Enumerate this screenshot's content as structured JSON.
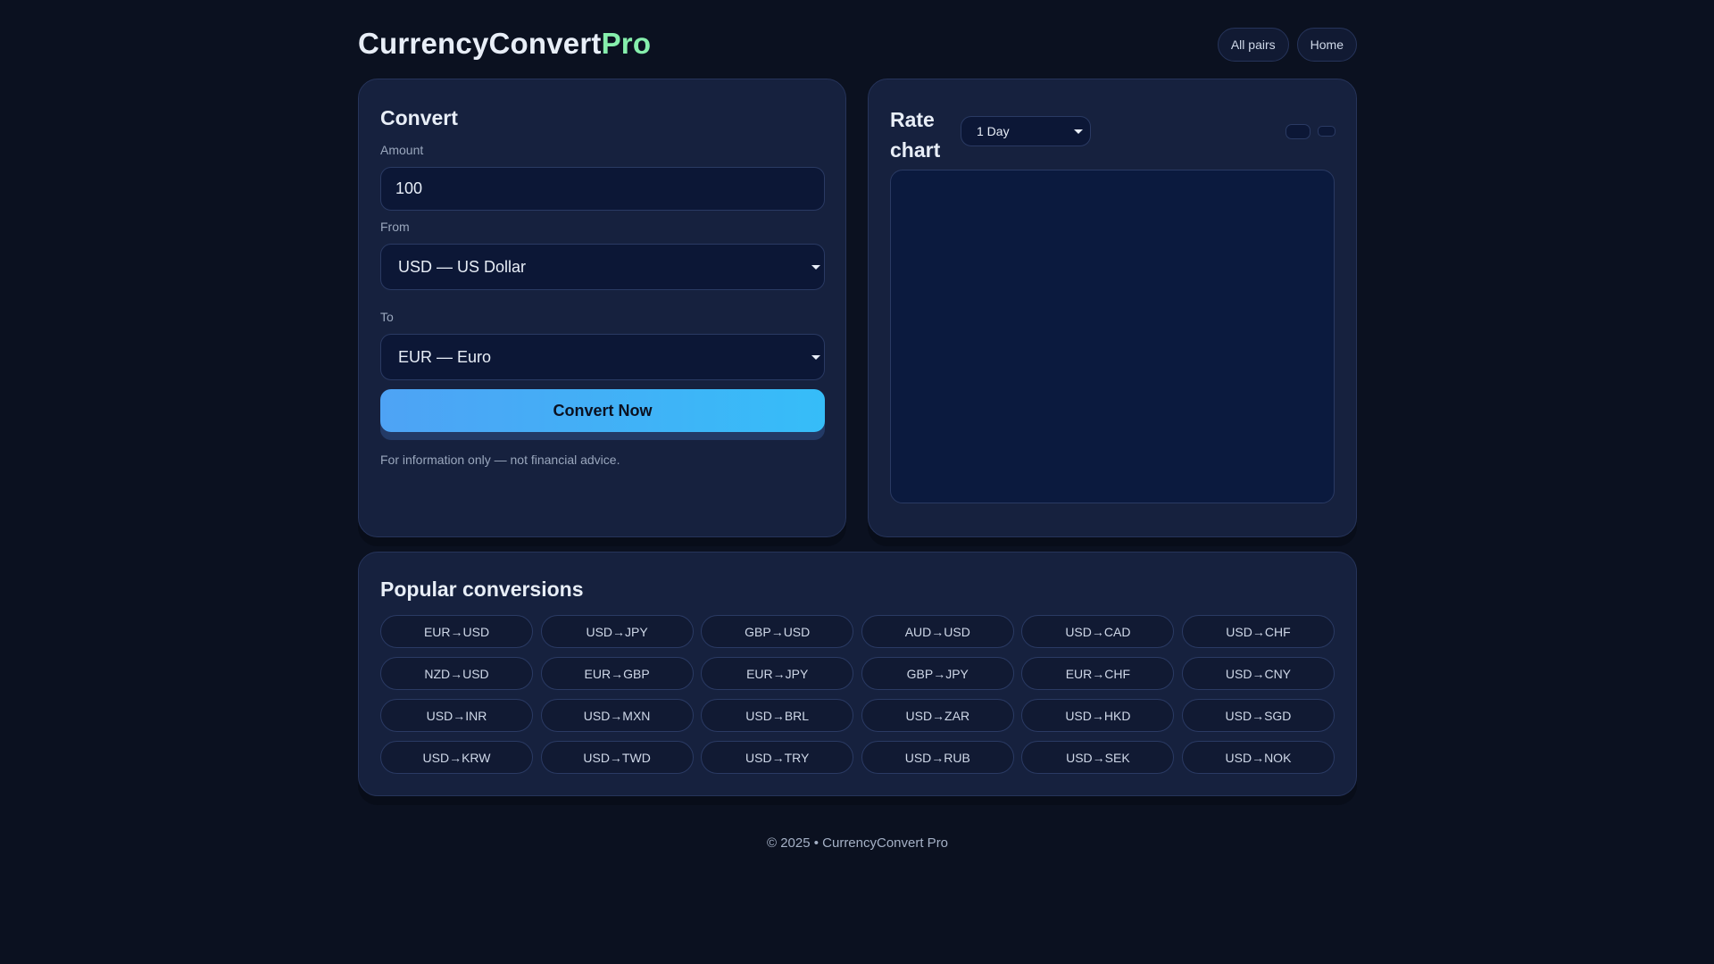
{
  "brand": {
    "name": "CurrencyConvert",
    "suffix": "Pro"
  },
  "nav": {
    "all_pairs": "All pairs",
    "home": "Home"
  },
  "converter": {
    "title": "Convert",
    "amount_label": "Amount",
    "amount_value": "100",
    "from_label": "From",
    "from_value": "USD — US Dollar",
    "to_label": "To",
    "to_value": "EUR — Euro",
    "button": "Convert Now",
    "note": "For information only — not financial advice."
  },
  "chart": {
    "title": "Rate chart",
    "range_value": "1 Day"
  },
  "popular": {
    "title": "Popular conversions",
    "pairs": [
      "EUR→USD",
      "USD→JPY",
      "GBP→USD",
      "AUD→USD",
      "USD→CAD",
      "USD→CHF",
      "NZD→USD",
      "EUR→GBP",
      "EUR→JPY",
      "GBP→JPY",
      "EUR→CHF",
      "USD→CNY",
      "USD→INR",
      "USD→MXN",
      "USD→BRL",
      "USD→ZAR",
      "USD→HKD",
      "USD→SGD",
      "USD→KRW",
      "USD→TWD",
      "USD→TRY",
      "USD→RUB",
      "USD→SEK",
      "USD→NOK"
    ]
  },
  "footer": "© 2025 • CurrencyConvert Pro"
}
